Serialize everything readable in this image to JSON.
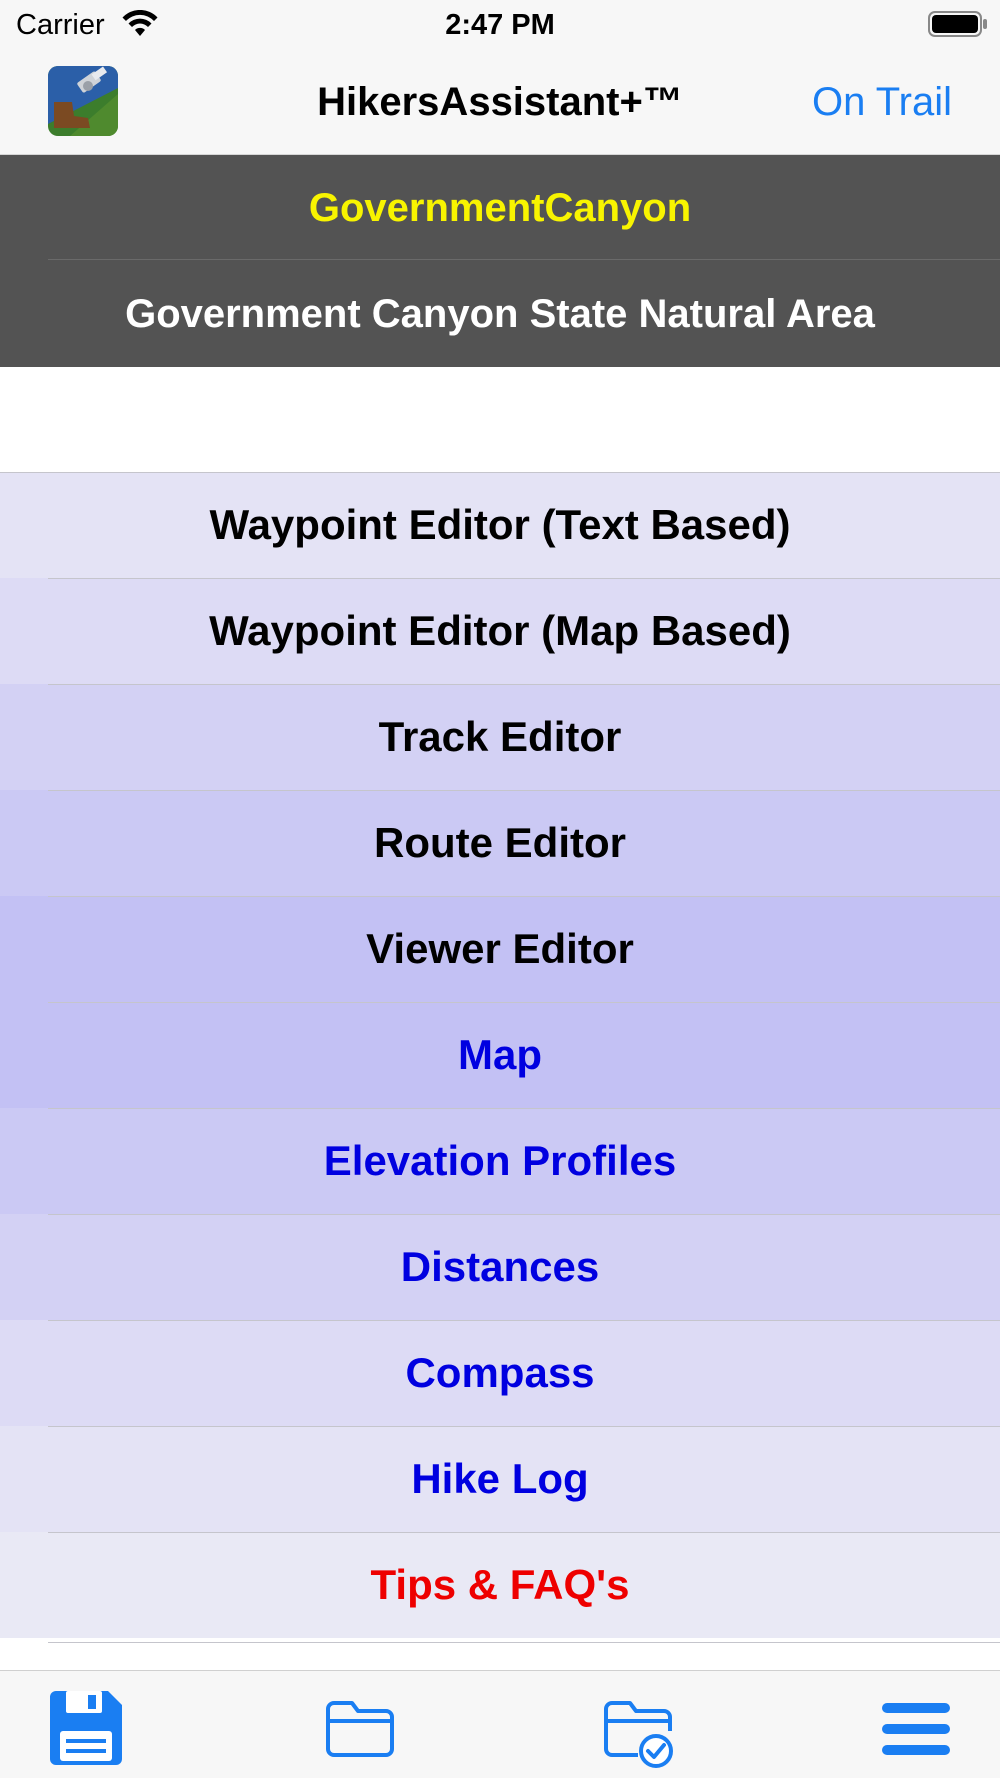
{
  "status_bar": {
    "carrier": "Carrier",
    "time": "2:47 PM",
    "wifi_icon": "wifi-icon",
    "battery_icon": "battery-full-icon"
  },
  "nav": {
    "logo_icon": "app-logo-icon",
    "title": "HikersAssistant+™",
    "action": "On Trail",
    "action_color": "#1a7ef2"
  },
  "trail": {
    "id": "GovernmentCanyon",
    "name": "Government Canyon State Natural Area",
    "id_color": "#f8f400",
    "header_bg": "#535353"
  },
  "menu": {
    "items": [
      {
        "label": "Waypoint Editor (Text Based)",
        "color": "#000000",
        "bg": "#e4e3f5"
      },
      {
        "label": "Waypoint Editor (Map Based)",
        "color": "#000000",
        "bg": "#dddbf5"
      },
      {
        "label": "Track Editor",
        "color": "#000000",
        "bg": "#d3d1f4"
      },
      {
        "label": "Route Editor",
        "color": "#000000",
        "bg": "#cbc9f4"
      },
      {
        "label": "Viewer Editor",
        "color": "#000000",
        "bg": "#c3c1f4"
      },
      {
        "label": "Map",
        "color": "#0000e0",
        "bg": "#c3c1f4"
      },
      {
        "label": "Elevation Profiles",
        "color": "#0000e0",
        "bg": "#cbc9f4"
      },
      {
        "label": "Distances",
        "color": "#0000e0",
        "bg": "#d3d1f4"
      },
      {
        "label": "Compass",
        "color": "#0000e0",
        "bg": "#dddbf5"
      },
      {
        "label": "Hike Log",
        "color": "#0000e0",
        "bg": "#e4e3f5"
      },
      {
        "label": "Tips & FAQ's",
        "color": "#ee0000",
        "bg": "#e9e9f5"
      }
    ]
  },
  "tab_bar": {
    "icons": [
      "save-disk-icon",
      "folder-icon",
      "folder-check-icon",
      "menu-icon"
    ],
    "accent": "#1a7ef2"
  }
}
